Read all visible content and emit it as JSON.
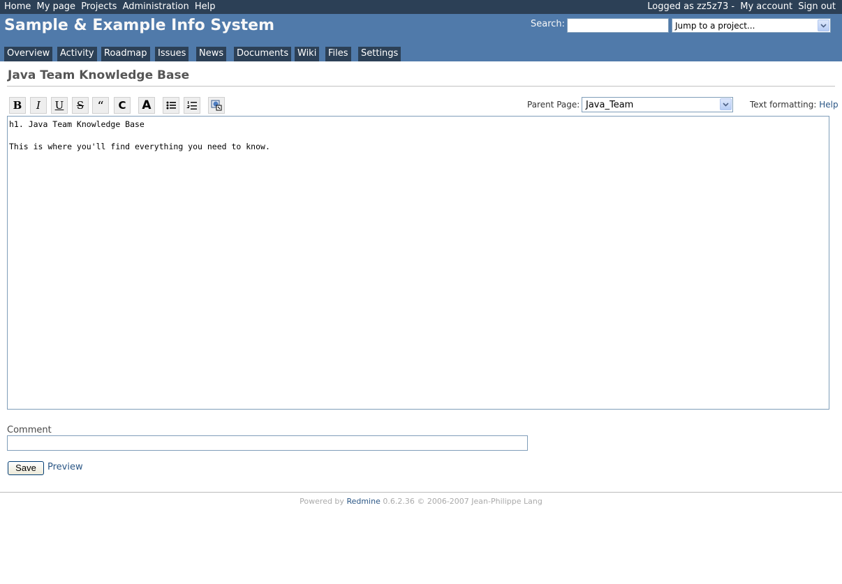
{
  "top_menu": {
    "left": [
      "Home",
      "My page",
      "Projects",
      "Administration",
      "Help"
    ],
    "logged_as": "Logged as zz5z73 -",
    "my_account": "My account",
    "sign_out": "Sign out"
  },
  "header": {
    "title": "Sample & Example Info System",
    "search_label": "Search:",
    "search_value": "",
    "jump_select": "Jump to a project..."
  },
  "main_menu": [
    "Overview",
    "Activity",
    "Roadmap",
    "Issues",
    "News",
    "Documents",
    "Wiki",
    "Files",
    "Settings"
  ],
  "page": {
    "title": "Java Team Knowledge Base",
    "toolbar": {
      "bold": "B",
      "italic": "I",
      "underline": "U",
      "strike": "S",
      "quote": "“",
      "code": "C",
      "heading": "A",
      "icons": [
        "bold-icon",
        "italic-icon",
        "underline-icon",
        "strikethrough-icon",
        "quote-icon",
        "code-icon",
        "heading-icon",
        "bullet-list-icon",
        "numbered-list-icon",
        "link-icon"
      ]
    },
    "parent_page_label": "Parent Page:",
    "parent_page_value": "Java_Team",
    "text_formatting_label": "Text formatting:",
    "text_formatting_help": "Help",
    "editor_text": "h1. Java Team Knowledge Base\n\nThis is where you'll find everything you need to know.",
    "comment_label": "Comment",
    "comment_value": "",
    "save_label": "Save",
    "preview_label": "Preview"
  },
  "footer": {
    "powered_by": "Powered by",
    "redmine": "Redmine",
    "rest": "0.6.2.36 © 2006-2007 Jean-Philippe Lang"
  },
  "colors": {
    "top_menu_bg": "#2c4056",
    "header_bg": "#507aaa",
    "link": "#2a5685"
  }
}
